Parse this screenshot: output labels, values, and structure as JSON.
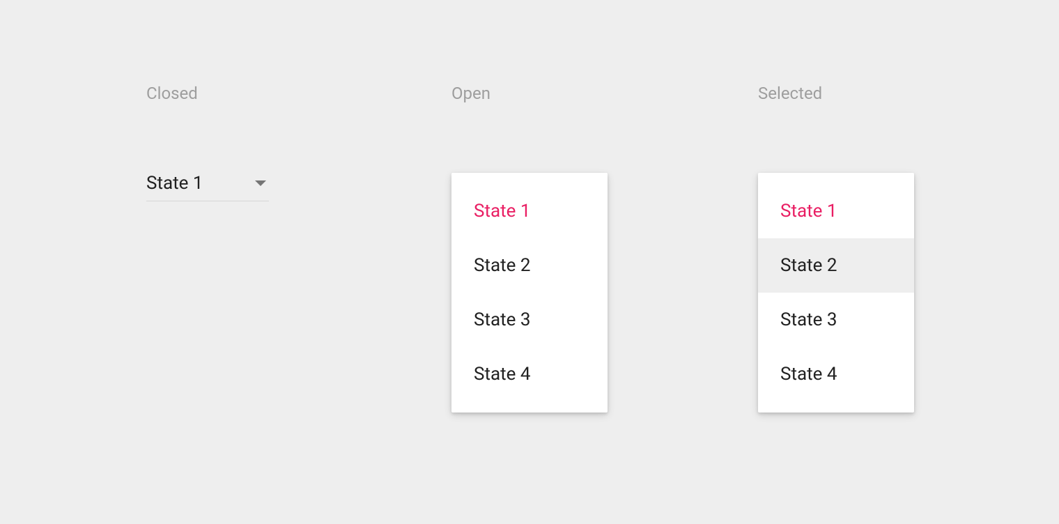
{
  "columns": {
    "closed": {
      "label": "Closed",
      "selected": "State 1"
    },
    "open": {
      "label": "Open",
      "items": [
        "State 1",
        "State 2",
        "State 3",
        "State 4"
      ]
    },
    "selected": {
      "label": "Selected",
      "items": [
        "State 1",
        "State 2",
        "State 3",
        "State 4"
      ]
    }
  },
  "colors": {
    "accent": "#e91e63",
    "background": "#eeeeee",
    "text": "#212121",
    "muted": "#9e9e9e"
  }
}
